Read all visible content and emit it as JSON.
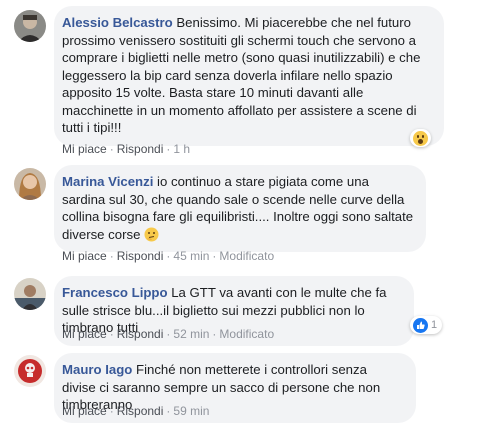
{
  "comments": [
    {
      "author": "Alessio Belcastro",
      "text": "Benissimo. Mi piacerebbe che nel futuro prossimo venissero sostituiti gli schermi touch che servono a comprare i biglietti nelle metro (sono quasi inutilizzabili) e che leggessero la bip card senza doverla infilare nello spazio apposito 15 volte. Basta stare 10 minuti davanti alle macchinette in un momento affollato per assistere a scene di tutti i tipi!!!",
      "like": "Mi piace",
      "reply": "Rispondi",
      "time": "1 h",
      "reaction": "wow-icon"
    },
    {
      "author": "Marina Vicenzi",
      "text": "io continuo a stare pigiata come una sardina sul 30, che quando sale o scende nelle curve della collina bisogna fare gli equilibristi.... Inoltre oggi sono saltate diverse corse",
      "like": "Mi piace",
      "reply": "Rispondi",
      "time": "45 min",
      "edited": "Modificato",
      "inline_emoji": "thinking-face-icon"
    },
    {
      "author": "Francesco Lippo",
      "text": "La GTT va avanti con le multe che fa sulle strisce blu...il biglietto sui mezzi pubblici non lo timbrano tutti",
      "like": "Mi piace",
      "reply": "Rispondi",
      "time": "52 min",
      "edited": "Modificato",
      "reaction": "like-icon",
      "reaction_count": "1"
    },
    {
      "author": "Mauro Iago",
      "text": "Finché non metterete i controllori senza divise ci saranno sempre un sacco di persone che non timbreranno",
      "like": "Mi piace",
      "reply": "Rispondi",
      "time": "59 min"
    }
  ],
  "colors": {
    "author": "#385898",
    "bubble": "#f2f3f5",
    "meta": "#90949c",
    "like_blue": "#1877f2"
  }
}
